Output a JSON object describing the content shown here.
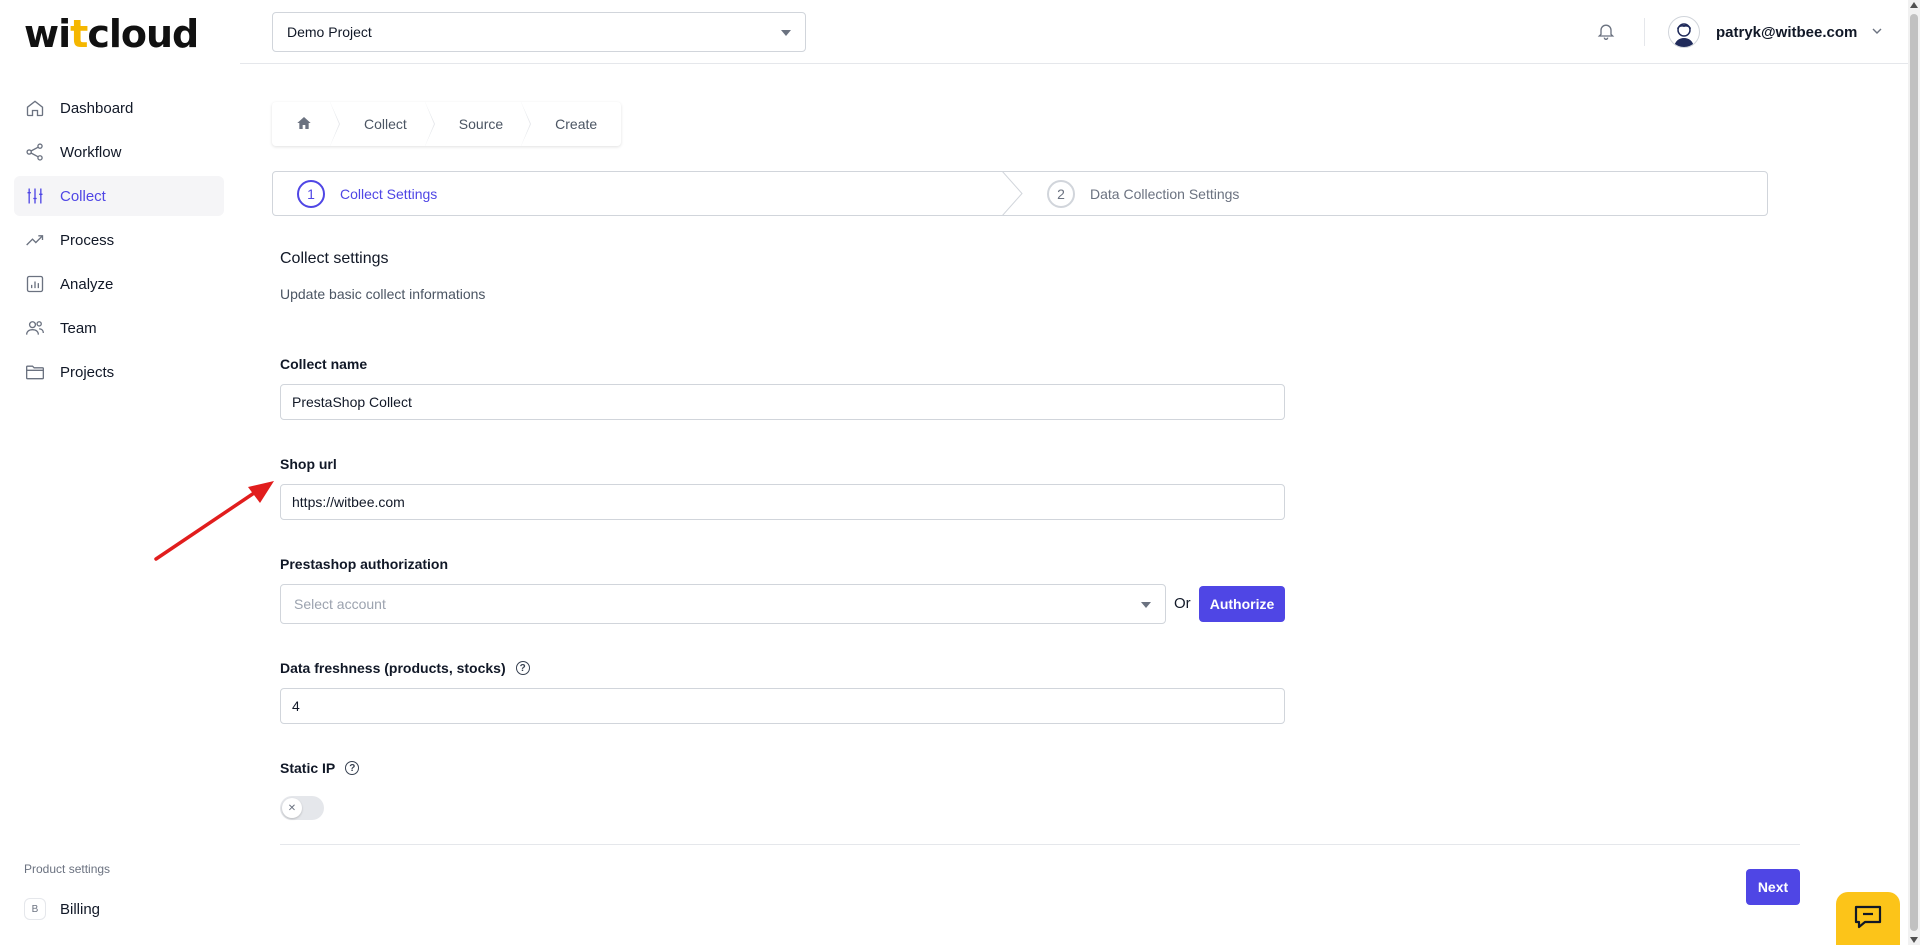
{
  "brand": {
    "logo_part1": "wi",
    "logo_accent": "t",
    "logo_part2": "cloud"
  },
  "sidebar": {
    "items": [
      {
        "label": "Dashboard",
        "icon": "home-icon"
      },
      {
        "label": "Workflow",
        "icon": "share-icon"
      },
      {
        "label": "Collect",
        "icon": "sliders-icon",
        "active": true
      },
      {
        "label": "Process",
        "icon": "trending-up-icon"
      },
      {
        "label": "Analyze",
        "icon": "bar-chart-icon"
      },
      {
        "label": "Team",
        "icon": "users-icon"
      },
      {
        "label": "Projects",
        "icon": "folder-icon"
      }
    ],
    "product_settings_label": "Product settings",
    "billing": {
      "badge": "B",
      "label": "Billing"
    }
  },
  "topbar": {
    "project_select_value": "Demo Project",
    "user_email": "patryk@witbee.com"
  },
  "breadcrumb": [
    "Collect",
    "Source",
    "Create"
  ],
  "steps": [
    {
      "number": "1",
      "label": "Collect Settings",
      "active": true
    },
    {
      "number": "2",
      "label": "Data Collection Settings",
      "active": false
    }
  ],
  "form": {
    "title": "Collect settings",
    "subtitle": "Update basic collect informations",
    "collect_name_label": "Collect name",
    "collect_name_value": "PrestaShop Collect",
    "shop_url_label": "Shop url",
    "shop_url_value": "https://witbee.com",
    "auth_label": "Prestashop authorization",
    "auth_placeholder": "Select account",
    "or_text": "Or",
    "authorize_button": "Authorize",
    "freshness_label": "Data freshness (products, stocks)",
    "freshness_value": "4",
    "static_ip_label": "Static IP",
    "static_ip_enabled": false,
    "help_glyph": "?",
    "toggle_glyph": "✕",
    "next_button": "Next"
  },
  "colors": {
    "accent": "#4f46e5",
    "logo_accent": "#f5b700",
    "chat_widget": "#fcc419",
    "annotation": "#e11d1d"
  }
}
